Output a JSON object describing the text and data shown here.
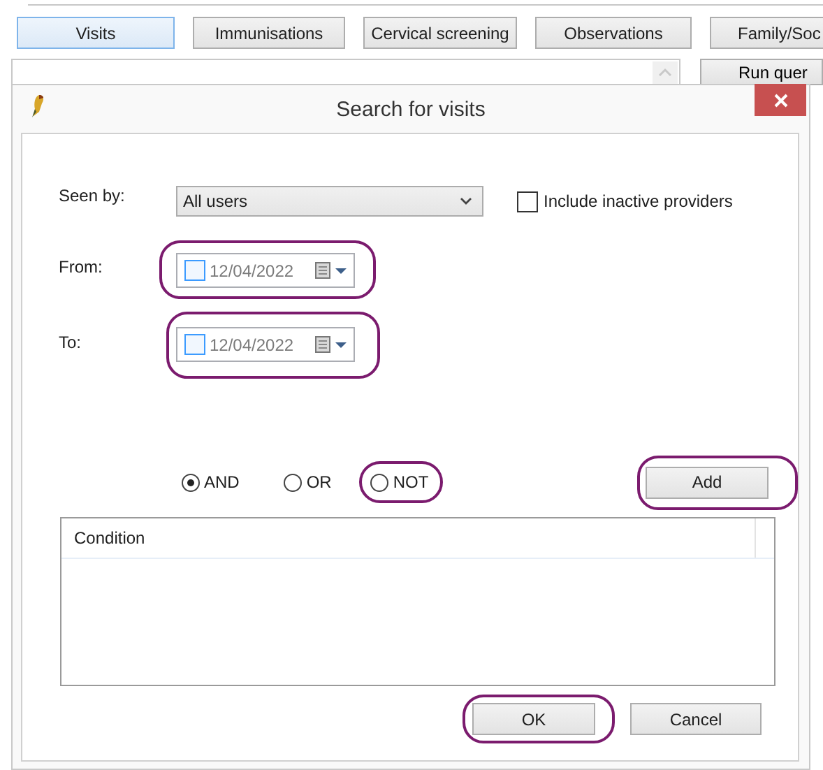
{
  "tabs": [
    {
      "label": "Visits",
      "selected": true
    },
    {
      "label": "Immunisations",
      "selected": false
    },
    {
      "label": "Cervical screening",
      "selected": false
    },
    {
      "label": "Observations",
      "selected": false
    },
    {
      "label": "Family/Soc",
      "selected": false
    }
  ],
  "run_query_button": "Run quer",
  "dialog": {
    "title": "Search for visits",
    "seen_by": {
      "label": "Seen by:",
      "value": "All users"
    },
    "include_inactive": {
      "label": "Include inactive providers",
      "checked": false
    },
    "dates": [
      {
        "label": "From:",
        "value": "12/04/2022",
        "checked": false,
        "highlighted": true
      },
      {
        "label": "To:",
        "value": "12/04/2022",
        "checked": false,
        "highlighted": true
      }
    ],
    "operators": [
      {
        "label": "AND",
        "selected": true,
        "highlighted": false
      },
      {
        "label": "OR",
        "selected": false,
        "highlighted": false
      },
      {
        "label": "NOT",
        "selected": false,
        "highlighted": true
      }
    ],
    "add_button": {
      "label": "Add",
      "highlighted": true
    },
    "list": {
      "columns": [
        "Condition"
      ]
    },
    "buttons": [
      {
        "label": "OK",
        "highlighted": true
      },
      {
        "label": "Cancel",
        "highlighted": false
      }
    ]
  }
}
